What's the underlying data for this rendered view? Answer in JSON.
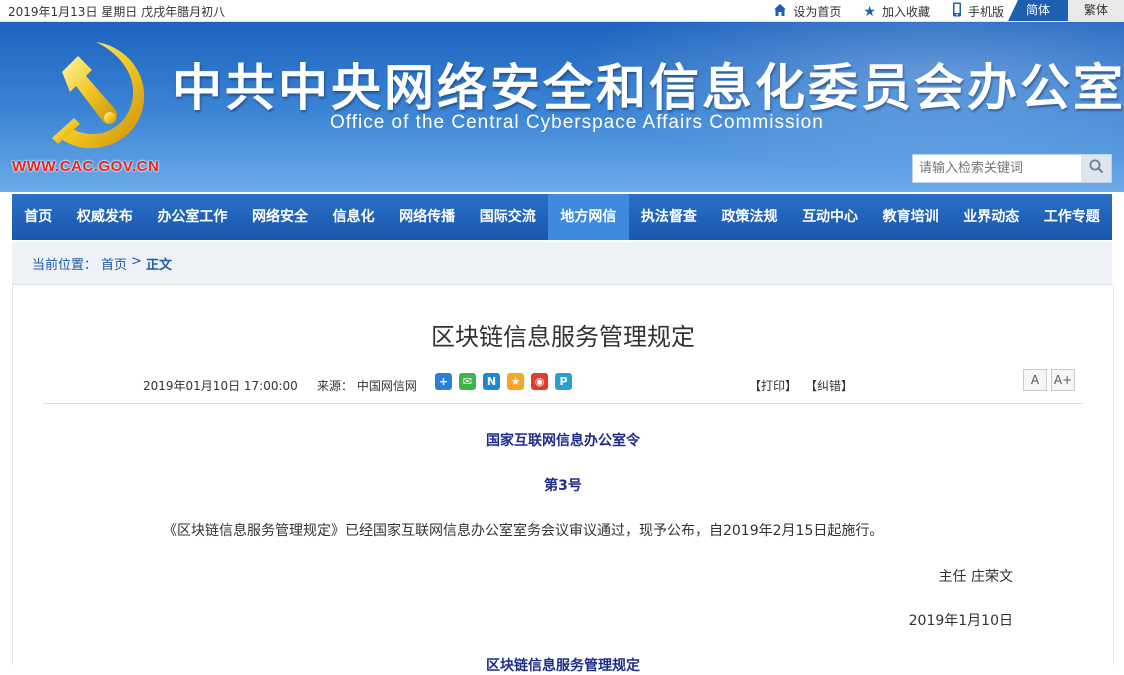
{
  "topbar": {
    "date": "2019年1月13日 星期日 戊戌年腊月初八",
    "links": [
      {
        "label": "设为首页",
        "icon": "home-icon"
      },
      {
        "label": "加入收藏",
        "icon": "star-icon"
      },
      {
        "label": "手机版",
        "icon": "mobile-icon"
      }
    ],
    "lang_simplified": "简体",
    "lang_traditional": "繁体"
  },
  "header": {
    "title_cn": "中共中央网络安全和信息化委员会办公室",
    "title_en": "Office of the Central Cyberspace Affairs Commission",
    "url": "WWW.CAC.GOV.CN",
    "search_placeholder": "请输入检索关键词"
  },
  "nav": {
    "items": [
      "首页",
      "权威发布",
      "办公室工作",
      "网络安全",
      "信息化",
      "网络传播",
      "国际交流",
      "地方网信",
      "执法督查",
      "政策法规",
      "互动中心",
      "教育培训",
      "业界动态",
      "工作专题"
    ],
    "active": "地方网信"
  },
  "breadcrumb": {
    "prefix": "当前位置：",
    "home": "首页",
    "sep": ">",
    "current": "正文"
  },
  "article": {
    "title": "区块链信息服务管理规定",
    "time": "2019年01月10日 17:00:00",
    "source": "来源： 中国网信网",
    "print": "【打印】",
    "correct": "【纠错】",
    "font_small": "A",
    "font_large": "A+",
    "order_title": "国家互联网信息办公室令",
    "order_number": "第3号",
    "body": "《区块链信息服务管理规定》已经国家互联网信息办公室室务会议审议通过，现予公布，自2019年2月15日起施行。",
    "signer": "主任  庄荣文",
    "sign_date": "2019年1月10日",
    "subtitle": "区块链信息服务管理规定"
  },
  "colors": {
    "nav_bg": "#1958ad",
    "nav_active": "#3f8ae0",
    "url_red": "#e8261d",
    "heading_navy": "#1f2d8a"
  }
}
